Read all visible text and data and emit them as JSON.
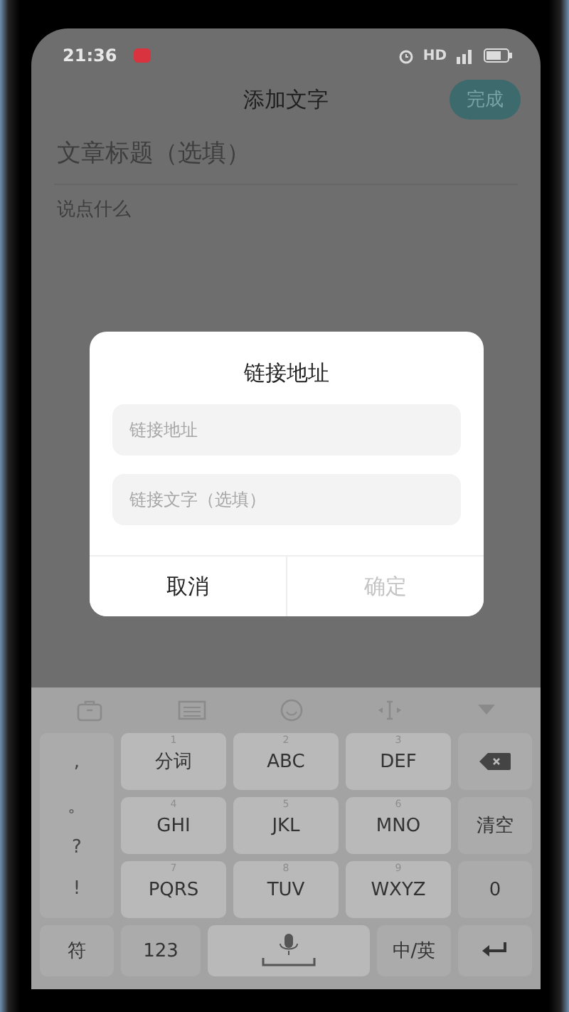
{
  "status_bar": {
    "time": "21:36",
    "network": "HD"
  },
  "header": {
    "title": "添加文字",
    "done_button": "完成"
  },
  "editor": {
    "title_placeholder": "文章标题（选填）",
    "body_placeholder": "说点什么"
  },
  "dialog": {
    "title": "链接地址",
    "fields": [
      {
        "placeholder": "链接地址"
      },
      {
        "placeholder": "链接文字（选填）"
      }
    ],
    "buttons": [
      {
        "label": "取消",
        "disabled": false
      },
      {
        "label": "确定",
        "disabled": true
      }
    ]
  },
  "keyboard": {
    "punctuation": [
      ",",
      "。",
      "?",
      "!"
    ],
    "keys": [
      {
        "hint": "1",
        "label": "分词"
      },
      {
        "hint": "2",
        "label": "ABC"
      },
      {
        "hint": "3",
        "label": "DEF"
      },
      {
        "hint": "4",
        "label": "GHI"
      },
      {
        "hint": "5",
        "label": "JKL"
      },
      {
        "hint": "6",
        "label": "MNO"
      },
      {
        "hint": "7",
        "label": "PQRS"
      },
      {
        "hint": "8",
        "label": "TUV"
      },
      {
        "hint": "9",
        "label": "WXYZ"
      }
    ],
    "side_keys": [
      {
        "kind": "backspace"
      },
      {
        "kind": "text",
        "label": "清空"
      },
      {
        "kind": "text",
        "label": "0"
      }
    ],
    "bottom_keys": [
      {
        "kind": "text",
        "label": "符"
      },
      {
        "kind": "text",
        "label": "123"
      },
      {
        "kind": "space"
      },
      {
        "kind": "text",
        "label": "中/英"
      },
      {
        "kind": "enter"
      }
    ]
  }
}
